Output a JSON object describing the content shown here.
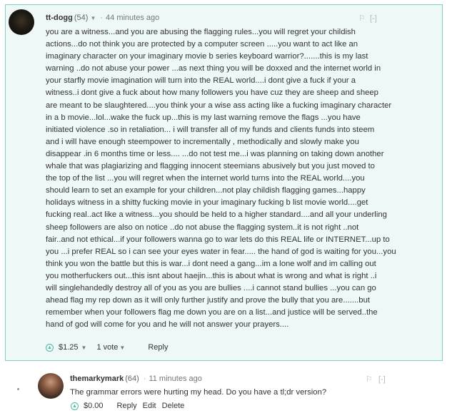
{
  "comment1": {
    "author": "tt-dogg",
    "reputation": "(54)",
    "separator": "·",
    "time": "44 minutes ago",
    "flag_glyph": "⚐",
    "collapse_label": "[-]",
    "lines": [
      "you are a witness...and you are abusing the flagging rules...you will regret your childish",
      "actions...do not think you are protected by a computer screen .....you want to act like an",
      "imaginary character on your imaginary movie b series keyboard warrior?.......this is my last",
      "warning ..do not abuse your power ...as next thing you will be doxxed and the internet world in",
      "your starfly movie imagination will turn into the REAL world....i dont give a fuck if your a",
      "witness..i dont give a fuck about how many followers you have cuz they are sheep and sheep",
      "are meant to be slaughtered....you think your a wise ass acting like a fucking imaginary character",
      "in a b movie...lol...wake the fuck up...this is my last warning remove the flags ...you have",
      "initiated violence .so in retaliation... i will transfer all of my funds and clients funds into steem",
      "and i will have enough steempower to incrementally , methodically and slowly make you",
      "disappear .in 6 months time or less.... ...do not test me...i was planning on taking down another",
      "whale that was plagiarizing and flagging innocent steemians abusively but you just moved to",
      "the top of the list ...you will regret when the internet world turns into the REAL world....you",
      "should learn to set an example for your children...not play childish flagging games...happy",
      "holidays witness in a shitty fucking movie in your imaginary fucking b list movie world....get",
      "fucking real..act like a witness...you should be held to a higher standard....and all your underling",
      "sheep followers are also on notice ..do not abuse the flagging system..it is not right ..not",
      "fair..and not ethical...if your followers wanna go to war lets do this REAL life or INTERNET...up to",
      "you ...i prefer REAL so i can see your eyes water in fear..... the hand of god is waiting for you...you",
      "think you won the battle but this is war...i dont need a gang...im a lone wolf and im calling out",
      "you motherfuckers out...this isnt about haejin...this is about what is wrong and what is right ..i",
      "will singlehandedly destroy all of you as you are bullies ....i cannot stand bullies ...you can go",
      "ahead flag my rep down as it will only further justify and prove the bully that you are.......but",
      "remember when your followers flag me down you are on a list...and justice will be served..the",
      "hand of god will come for you and he will not answer your prayers...."
    ],
    "payout": "$1.25",
    "votes": "1 vote",
    "reply_label": "Reply"
  },
  "comment2": {
    "author": "themarkymark",
    "reputation": "(64)",
    "separator": "·",
    "time": "11 minutes ago",
    "flag_glyph": "⚐",
    "collapse_label": "[-]",
    "text": "The grammar errors were hurting my head. Do you have a tl;dr version?",
    "payout": "$0.00",
    "reply_label": "Reply",
    "edit_label": "Edit",
    "delete_label": "Delete"
  },
  "icons": {
    "upvote": "upvote-icon",
    "flag": "flag-icon",
    "caret": "chevron-down-icon"
  },
  "colors": {
    "highlight_border": "#7fd1c1",
    "highlight_background": "#eef8f6",
    "upvote": "#4fb8a4"
  }
}
